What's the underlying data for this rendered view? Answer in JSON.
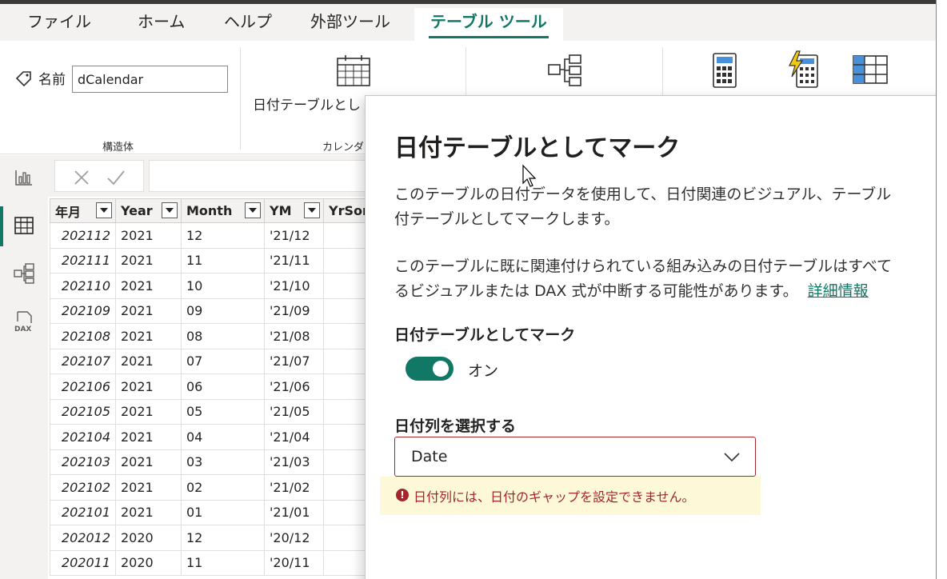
{
  "tabs": {
    "file": "ファイル",
    "home": "ホーム",
    "help": "ヘルプ",
    "external": "外部ツール",
    "table_tools": "テーブル ツール"
  },
  "ribbon": {
    "name_label": "名前",
    "name_value": "dCalendar",
    "group_structure": "構造体",
    "mark_date_button": "日付テーブルとし",
    "group_calendar": "カレンダ"
  },
  "grid": {
    "columns": [
      "年月",
      "Year",
      "Month",
      "YM",
      "YrSort"
    ],
    "rows": [
      [
        "202112",
        "2021",
        "12",
        "'21/12"
      ],
      [
        "202111",
        "2021",
        "11",
        "'21/11"
      ],
      [
        "202110",
        "2021",
        "10",
        "'21/10"
      ],
      [
        "202109",
        "2021",
        "09",
        "'21/09"
      ],
      [
        "202108",
        "2021",
        "08",
        "'21/08"
      ],
      [
        "202107",
        "2021",
        "07",
        "'21/07"
      ],
      [
        "202106",
        "2021",
        "06",
        "'21/06"
      ],
      [
        "202105",
        "2021",
        "05",
        "'21/05"
      ],
      [
        "202104",
        "2021",
        "04",
        "'21/04"
      ],
      [
        "202103",
        "2021",
        "03",
        "'21/03"
      ],
      [
        "202102",
        "2021",
        "02",
        "'21/02"
      ],
      [
        "202101",
        "2021",
        "01",
        "'21/01"
      ],
      [
        "202012",
        "2020",
        "12",
        "'20/12"
      ],
      [
        "202011",
        "2020",
        "11",
        "'20/11"
      ]
    ]
  },
  "dialog": {
    "title": "日付テーブルとしてマーク",
    "para1_line1": "このテーブルの日付データを使用して、日付関連のビジュアル、テーブル",
    "para1_line2": "付テーブルとしてマークします。",
    "para2_line1": "このテーブルに既に関連付けられている組み込みの日付テーブルはすべて",
    "para2_line2": "るビジュアルまたは DAX 式が中断する可能性があります。",
    "learn_more": "詳細情報",
    "toggle_heading": "日付テーブルとしてマーク",
    "toggle_state": "オン",
    "select_heading": "日付列を選択する",
    "select_value": "Date",
    "error_message": "日付列には、日付のギャップを設定できません。"
  },
  "colors": {
    "accent": "#117865",
    "error": "#a4262c",
    "warning_bg": "#fdf9d8"
  },
  "icons": {
    "name": "tag-icon",
    "calendar": "calendar-icon",
    "hierarchy": "hierarchy-icon",
    "calculator": "calculator-icon",
    "quick_measure": "quick-measure-icon",
    "table": "table-icon"
  }
}
